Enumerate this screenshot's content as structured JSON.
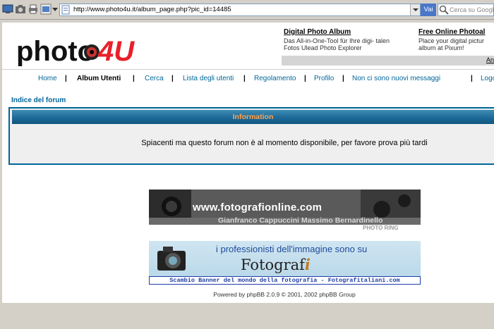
{
  "browser": {
    "url": "http://www.photo4u.it/album_page.php?pic_id=14485",
    "go_label": "Vai",
    "search_placeholder": "Cerca su Google",
    "toolbar_icons": [
      "monitor-icon",
      "printer-icon",
      "home-icon",
      "app-icon",
      "dropdown-icon"
    ]
  },
  "header": {
    "logo_text_1": "photo",
    "logo_text_2": "4U",
    "ads": [
      {
        "title": "Digital Photo Album",
        "lines": [
          "Das All-in-One-Tool für Ihre digi- talen",
          "Fotos Ulead Photo Explorer"
        ]
      },
      {
        "title": "Free Online Photoal",
        "lines": [
          "Place your digital pictur",
          "album at Pixum!"
        ]
      }
    ],
    "ads_more": "An"
  },
  "nav": {
    "items": [
      "Home",
      "Album Utenti",
      "Cerca",
      "Lista degli utenti",
      "Regolamento",
      "Profilo",
      "Non ci sono nuovi messaggi",
      "Logout [ c"
    ],
    "separator": "|"
  },
  "forum": {
    "index_link": "Indice del forum",
    "box_title": "Information",
    "message": "Spiacenti ma questo forum non è al momento disponibile, per favore prova più tardi"
  },
  "banners": {
    "b1_url": "www.fotografionline.com",
    "b1_names": "Gianfranco Cappuccini Massimo Bernardinello",
    "photo_ring": "PHOTO RING",
    "b2_tagline": "i professionisti dell'immagine sono su",
    "b2_brand_main": "Fotograf",
    "b2_brand_i": "i",
    "b2_footer": "Scambio Banner del mondo della fotografia - Fotografitaliani.com"
  },
  "footer": {
    "powered": "Powered by phpBB 2.0.9 © 2001, 2002 phpBB Group"
  },
  "colors": {
    "nav_link": "#006699",
    "header_gradient_top": "#3f8bb3",
    "header_title": "#ffa34f",
    "logo_red": "#e8202a"
  }
}
